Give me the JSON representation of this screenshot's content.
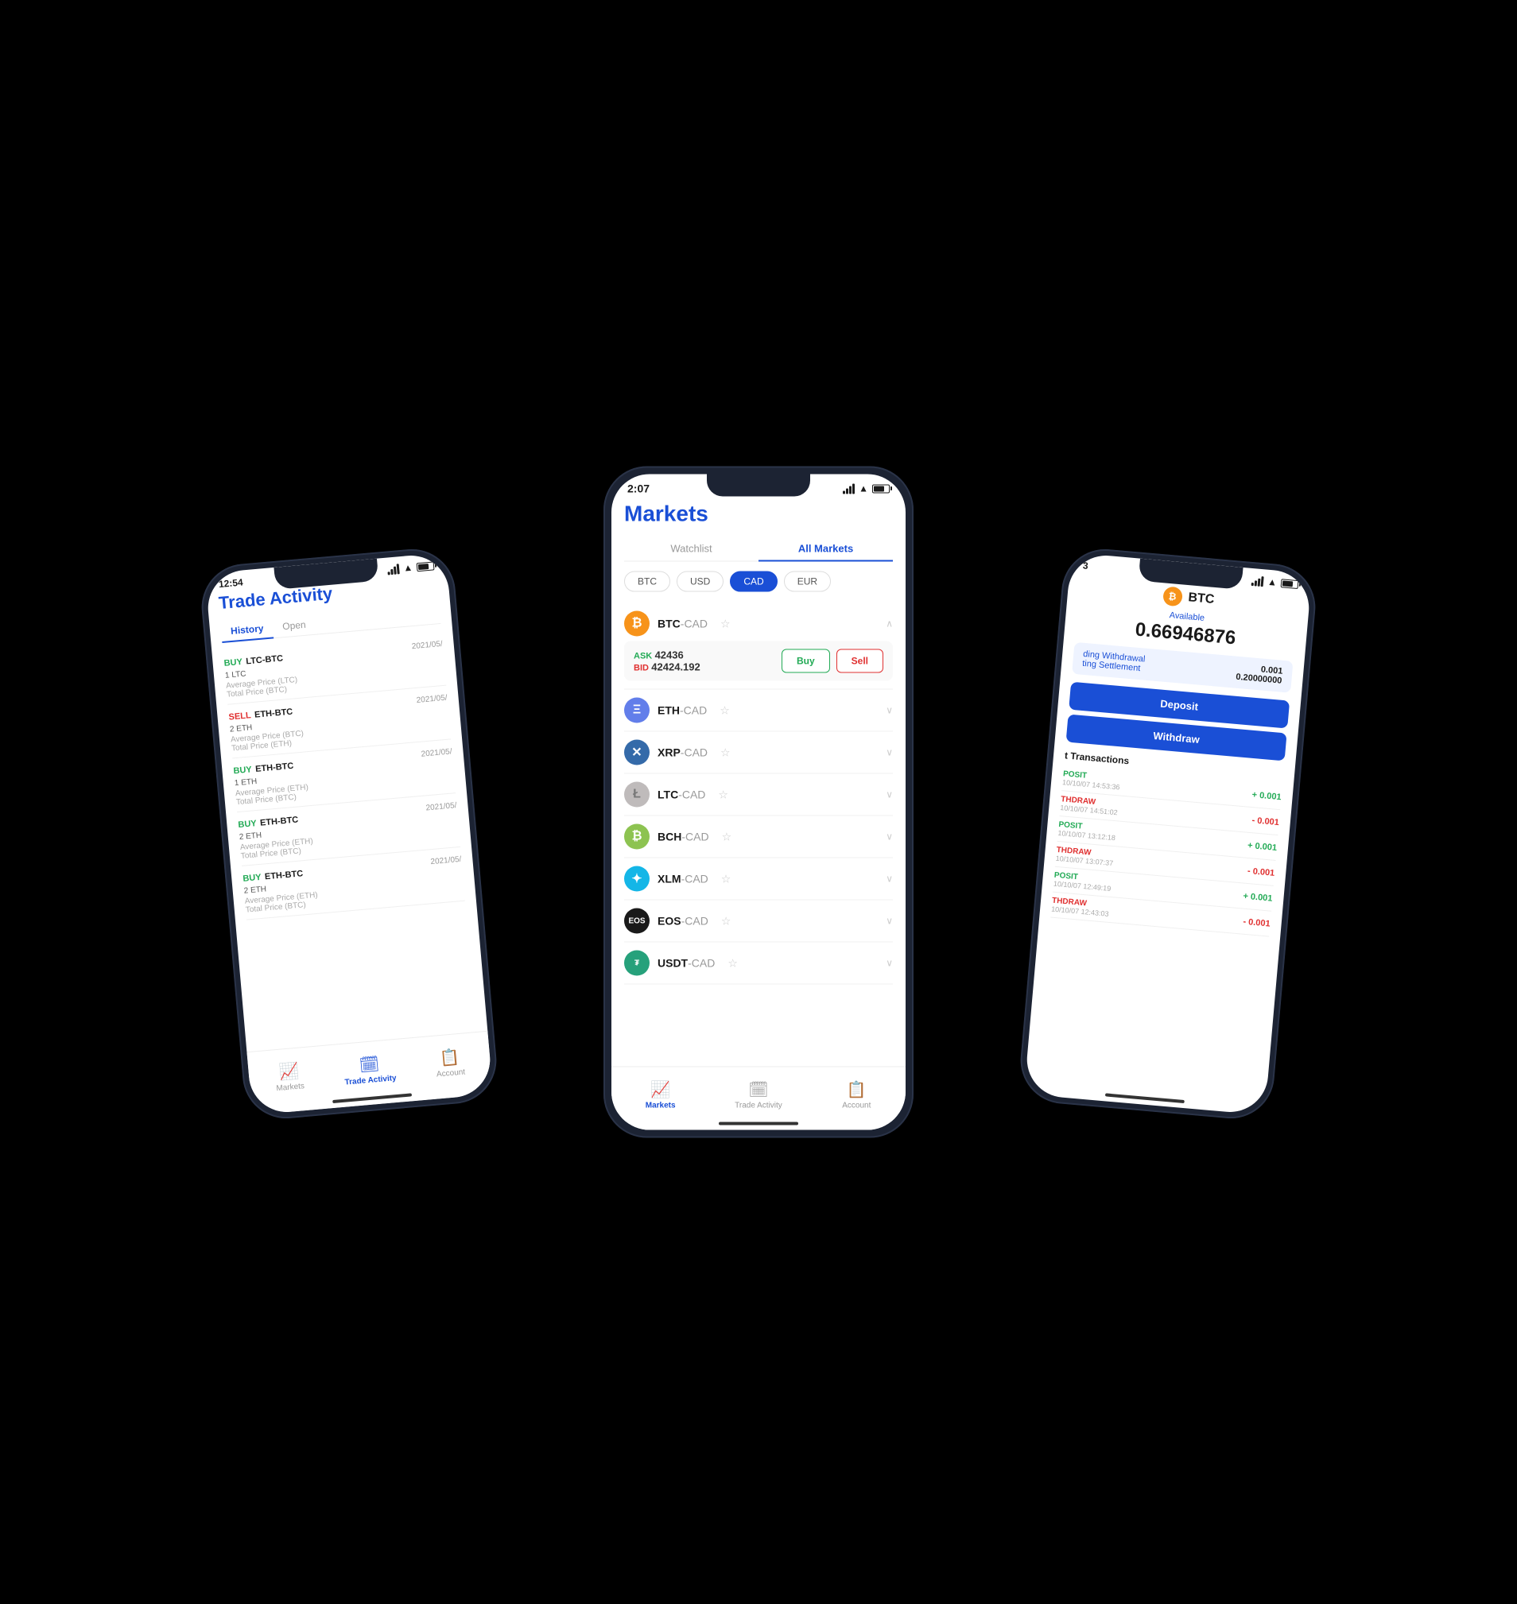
{
  "scene": {
    "background": "#000000"
  },
  "center_phone": {
    "status_bar": {
      "time": "2:07",
      "signal": "signal",
      "wifi": "wifi",
      "battery": "battery"
    },
    "screen": {
      "title": "Markets",
      "tabs": [
        {
          "label": "Watchlist",
          "active": false
        },
        {
          "label": "All Markets",
          "active": true
        }
      ],
      "filters": [
        {
          "label": "BTC",
          "active": false
        },
        {
          "label": "USD",
          "active": false
        },
        {
          "label": "CAD",
          "active": true
        },
        {
          "label": "EUR",
          "active": false
        }
      ],
      "markets": [
        {
          "pair": "BTC",
          "quote": "CAD",
          "expanded": true,
          "ask_label": "ASK",
          "ask_val": "42436",
          "bid_label": "BID",
          "bid_val": "42424.192",
          "buy_label": "Buy",
          "sell_label": "Sell"
        },
        {
          "pair": "ETH",
          "quote": "CAD",
          "expanded": false
        },
        {
          "pair": "XRP",
          "quote": "CAD",
          "expanded": false
        },
        {
          "pair": "LTC",
          "quote": "CAD",
          "expanded": false
        },
        {
          "pair": "BCH",
          "quote": "CAD",
          "expanded": false
        },
        {
          "pair": "XLM",
          "quote": "CAD",
          "expanded": false
        },
        {
          "pair": "EOS",
          "quote": "CAD",
          "expanded": false
        },
        {
          "pair": "USDT",
          "quote": "CAD",
          "expanded": false
        }
      ]
    },
    "bottom_nav": [
      {
        "label": "Markets",
        "icon": "📈",
        "active": true
      },
      {
        "label": "Trade Activity",
        "icon": "🗓",
        "active": false
      },
      {
        "label": "Account",
        "icon": "📋",
        "active": false
      }
    ]
  },
  "left_phone": {
    "status_bar": {
      "time": "12:54"
    },
    "screen": {
      "title": "Trade Activity",
      "tabs": [
        {
          "label": "History",
          "active": true
        },
        {
          "label": "Open",
          "active": false
        }
      ],
      "trades": [
        {
          "action": "BUY",
          "type": "buy",
          "pair": "LTC-BTC",
          "date": "2021/05/",
          "amount": "1 LTC",
          "avg_price": "Average Price (LTC)",
          "total_price": "Total Price (BTC)"
        },
        {
          "action": "SELL",
          "type": "sell",
          "pair": "ETH-BTC",
          "date": "2021/05/",
          "amount": "2 ETH",
          "avg_price": "Average Price (BTC)",
          "total_price": "Total Price (ETH)"
        },
        {
          "action": "BUY",
          "type": "buy",
          "pair": "ETH-BTC",
          "date": "2021/05/",
          "amount": "1 ETH",
          "avg_price": "Average Price (ETH)",
          "total_price": "Total Price (BTC)"
        },
        {
          "action": "BUY",
          "type": "buy",
          "pair": "ETH-BTC",
          "date": "2021/05/",
          "amount": "2 ETH",
          "avg_price": "Average Price (ETH)",
          "total_price": "Total Price (BTC)"
        },
        {
          "action": "BUY",
          "type": "buy",
          "pair": "ETH-BTC",
          "date": "2021/05/",
          "amount": "2 ETH",
          "avg_price": "Average Price (ETH)",
          "total_price": "Total Price (BTC)"
        }
      ]
    },
    "bottom_nav": [
      {
        "label": "Markets",
        "icon": "📈",
        "active": false
      },
      {
        "label": "Trade Activity",
        "icon": "🗓",
        "active": true
      },
      {
        "label": "Account",
        "icon": "📋",
        "active": false
      }
    ]
  },
  "right_phone": {
    "status_bar": {
      "time": "3"
    },
    "screen": {
      "coin": "BTC",
      "available_label": "Available",
      "available_amount": "0.66946876",
      "pending": [
        {
          "label": "ding Withdrawal",
          "value": "0.001"
        },
        {
          "label": "ting Settlement",
          "value": "0.20000000"
        }
      ],
      "deposit_label": "Deposit",
      "withdraw_label": "Withdraw",
      "transactions_title": "t Transactions",
      "transactions": [
        {
          "type": "POSIT",
          "type_class": "deposit",
          "date": "10/10/07 14:53:36",
          "amount": "+ 0.001",
          "amount_class": "pos"
        },
        {
          "type": "THDRAW",
          "type_class": "withdraw",
          "date": "10/10/07 14:51:02",
          "amount": "- 0.001",
          "amount_class": "neg"
        },
        {
          "type": "POSIT",
          "type_class": "deposit",
          "date": "10/10/07 13:12:18",
          "amount": "+ 0.001",
          "amount_class": "pos"
        },
        {
          "type": "THDRAW",
          "type_class": "withdraw",
          "date": "10/10/07 13:07:37",
          "amount": "- 0.001",
          "amount_class": "neg"
        },
        {
          "type": "POSIT",
          "type_class": "deposit",
          "date": "10/10/07 12:49:19",
          "amount": "+ 0.001",
          "amount_class": "pos"
        },
        {
          "type": "THDRAW",
          "type_class": "withdraw",
          "date": "10/10/07 12:43:03",
          "amount": "- 0.001",
          "amount_class": "neg"
        }
      ]
    }
  }
}
